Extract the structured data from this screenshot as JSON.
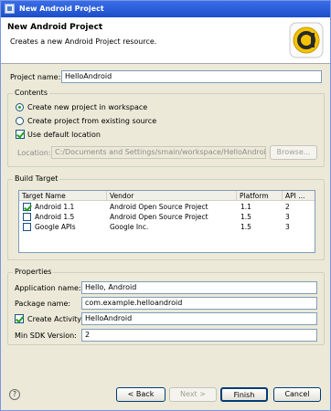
{
  "window": {
    "title": "New Android Project"
  },
  "banner": {
    "title": "New Android Project",
    "description": "Creates a new Android Project resource."
  },
  "project_name": {
    "label": "Project name:",
    "value": "HelloAndroid"
  },
  "contents": {
    "legend": "Contents",
    "option_new": "Create new project in workspace",
    "option_existing": "Create project from existing source",
    "use_default_location": "Use default location",
    "location_label": "Location:",
    "location_value": "C:/Documents and Settings/smain/workspace/HelloAndroid",
    "browse_label": "Browse..."
  },
  "build_target": {
    "legend": "Build Target",
    "columns": [
      "Target Name",
      "Vendor",
      "Platform",
      "API ..."
    ],
    "rows": [
      {
        "checked": true,
        "name": "Android 1.1",
        "vendor": "Android Open Source Project",
        "platform": "1.1",
        "api": "2"
      },
      {
        "checked": false,
        "name": "Android 1.5",
        "vendor": "Android Open Source Project",
        "platform": "1.5",
        "api": "3"
      },
      {
        "checked": false,
        "name": "Google APIs",
        "vendor": "Google Inc.",
        "platform": "1.5",
        "api": "3"
      }
    ]
  },
  "properties": {
    "legend": "Properties",
    "application_name_label": "Application name:",
    "application_name_value": "Hello, Android",
    "package_name_label": "Package name:",
    "package_name_value": "com.example.helloandroid",
    "create_activity_label": "Create Activity:",
    "create_activity_value": "HelloAndroid",
    "min_sdk_label": "Min SDK Version:",
    "min_sdk_value": "2"
  },
  "buttons": {
    "back": "< Back",
    "next": "Next >",
    "finish": "Finish",
    "cancel": "Cancel"
  },
  "help": {
    "glyph": "?"
  },
  "colors": {
    "title_bar": "#1c4ec9",
    "logo_yellow": "#f5c400",
    "check_green": "#21a121"
  },
  "icons": {
    "logo": "android-adt-logo-icon",
    "help": "help-icon"
  }
}
